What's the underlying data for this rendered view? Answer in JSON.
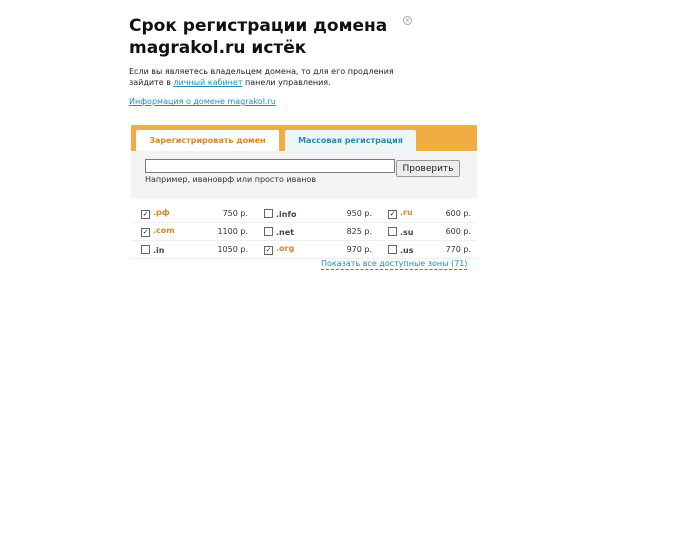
{
  "header": {
    "title_line1": "Срок регистрации домена",
    "title_line2": "magrakol.ru истёк"
  },
  "intro": {
    "text_before": "Если вы являетесь владельцем домена, то для его продления зайдите в ",
    "link": "личный кабинет",
    "text_after": " панели управления."
  },
  "info_link": "Информация о домене magrakol.ru",
  "tabs": {
    "register": "Зарегистрировать домен",
    "bulk": "Массовая регистрация"
  },
  "search": {
    "value": "",
    "placeholder": "",
    "button_label": "Проверить",
    "hint": "Например, ивановрф или просто иванов"
  },
  "zones": [
    [
      {
        "checked": true,
        "name": ".рф",
        "price": "750 р."
      },
      {
        "checked": false,
        "name": ".info",
        "price": "950 р."
      },
      {
        "checked": true,
        "name": ".ru",
        "price": "600 р."
      }
    ],
    [
      {
        "checked": true,
        "name": ".com",
        "price": "1100 р."
      },
      {
        "checked": false,
        "name": ".net",
        "price": "825 р."
      },
      {
        "checked": false,
        "name": ".su",
        "price": "600 р."
      }
    ],
    [
      {
        "checked": false,
        "name": ".in",
        "price": "1050 р."
      },
      {
        "checked": true,
        "name": ".org",
        "price": "970 р."
      },
      {
        "checked": false,
        "name": ".us",
        "price": "770 р."
      }
    ]
  ],
  "show_all_link": "Показать все доступные зоны (71)",
  "colors": {
    "accent_orange": "#f2ac44",
    "link_blue": "#1a8fb5",
    "zone_selected": "#d4862c"
  }
}
